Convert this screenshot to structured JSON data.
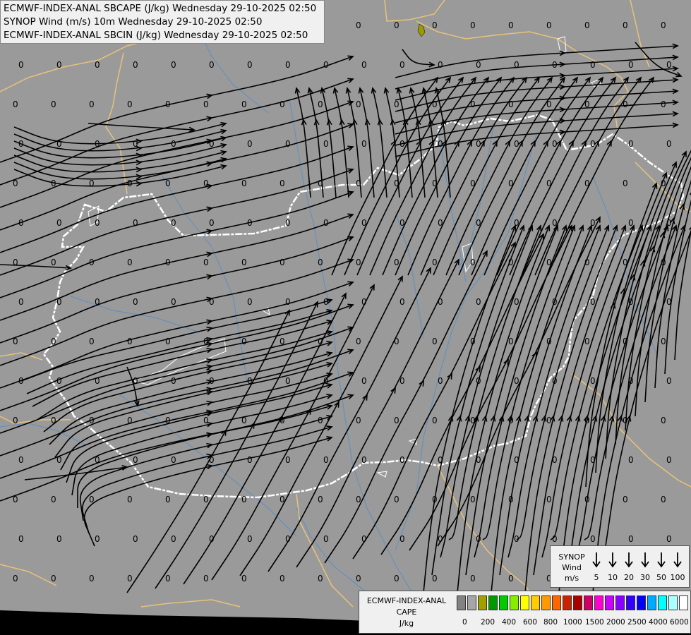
{
  "header": {
    "line1": "ECMWF-INDEX-ANAL SBCAPE (J/kg) Wednesday 29-10-2025 02:50",
    "line2": "SYNOP Wind (m/s) 10m Wednesday 29-10-2025 02:50",
    "line3": "ECMWF-INDEX-ANAL SBCIN (J/kg) Wednesday 29-10-2025 02:50"
  },
  "colors": {
    "background": "#9a9a9a",
    "border_country": "#e8c27a",
    "border_hungary": "#ffffff",
    "river": "#5d8fc2",
    "streamline": "#000000",
    "cape_blob": "#9a9a00"
  },
  "map_value_label": "0",
  "wind_legend": {
    "title": [
      "SYNOP",
      "Wind",
      "m/s"
    ],
    "speeds": [
      "5",
      "10",
      "20",
      "30",
      "50",
      "100"
    ],
    "arrow_icon": "down-arrow-icon"
  },
  "cape_legend": {
    "title": [
      "ECMWF-INDEX-ANAL",
      "CAPE",
      "J/kg"
    ],
    "colors": [
      "#828282",
      "#a6a6a6",
      "#a0a000",
      "#009900",
      "#00cc00",
      "#88ee00",
      "#ffff00",
      "#ffcc00",
      "#ff9900",
      "#ff6600",
      "#cc2200",
      "#aa0000",
      "#cc0066",
      "#ff00cc",
      "#cc00ff",
      "#8800ff",
      "#3300ff",
      "#0000ff",
      "#00aaff",
      "#00ffff",
      "#aaffff",
      "#ffffff"
    ],
    "ticks": [
      "0",
      "200",
      "400",
      "600",
      "800",
      "1000",
      "1500",
      "2000",
      "2500",
      "4000",
      "6000"
    ]
  }
}
